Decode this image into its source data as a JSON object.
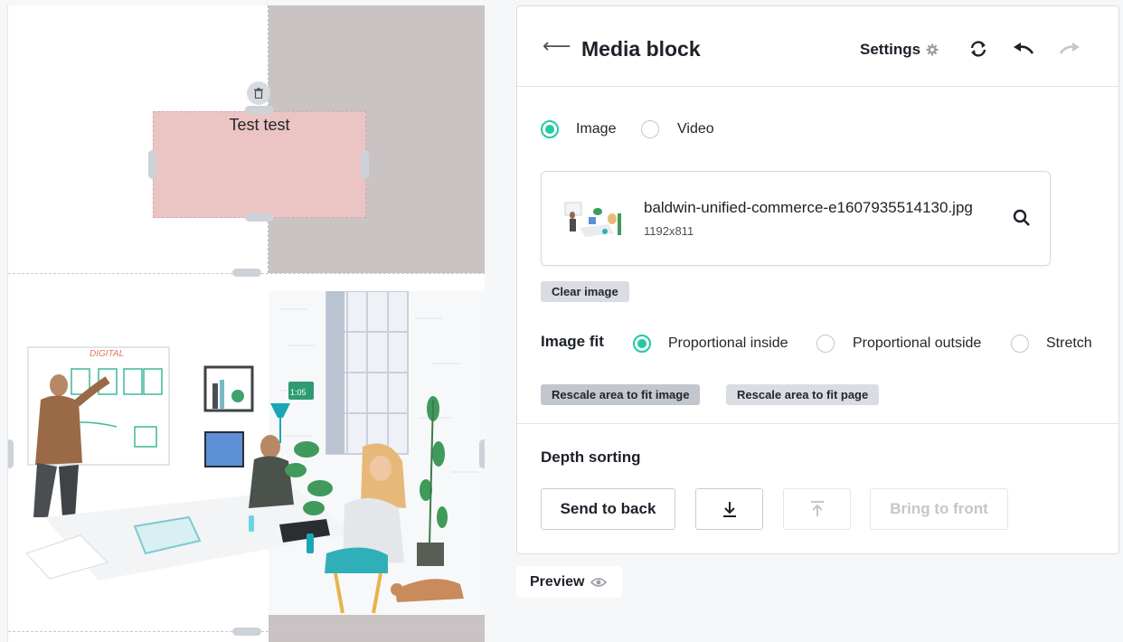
{
  "canvas": {
    "text_block": "Test test"
  },
  "panel": {
    "title": "Media block",
    "settings_label": "Settings",
    "media_type": {
      "options": [
        "Image",
        "Video"
      ],
      "selected": "Image"
    },
    "file": {
      "name": "baldwin-unified-commerce-e1607935514130.jpg",
      "dimensions": "1192x811"
    },
    "clear_image_label": "Clear image",
    "image_fit": {
      "label": "Image fit",
      "options": [
        "Proportional inside",
        "Proportional outside",
        "Stretch"
      ],
      "selected": "Proportional inside"
    },
    "rescale_image_label": "Rescale area to fit image",
    "rescale_page_label": "Rescale area to fit page",
    "depth_sorting": {
      "label": "Depth sorting",
      "send_to_back": "Send to back",
      "bring_to_front": "Bring to front"
    }
  },
  "preview_label": "Preview",
  "colors": {
    "accent": "#22c9a4",
    "text": "#1d2129",
    "placeholder_gray": "#c9c3c3",
    "text_block_bg": "#ebc4c4"
  },
  "icons": [
    "back-arrow-icon",
    "gear-icon",
    "refresh-icon",
    "undo-icon",
    "redo-icon",
    "search-icon",
    "trash-icon",
    "move-down-icon",
    "move-up-icon",
    "eye-icon"
  ]
}
